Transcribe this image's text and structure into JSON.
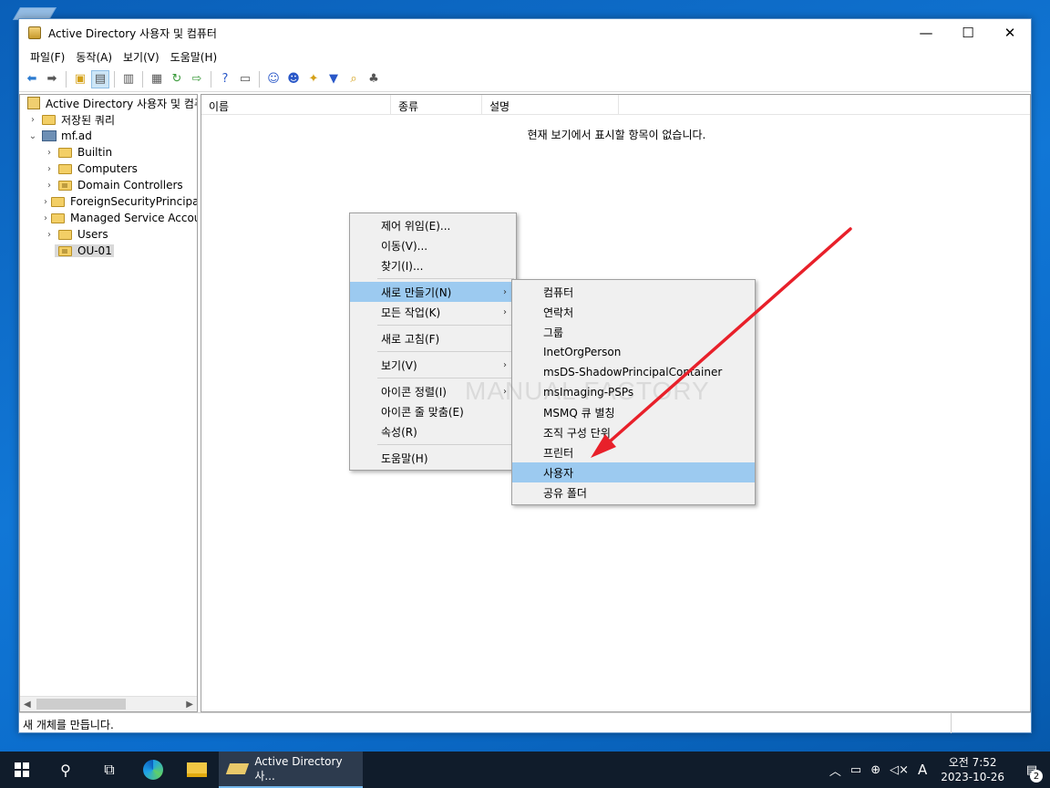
{
  "window": {
    "title": "Active Directory 사용자 및 컴퓨터",
    "controls": {
      "minimize": "—",
      "maximize": "☐",
      "close": "✕"
    }
  },
  "menubar": [
    "파일(F)",
    "동작(A)",
    "보기(V)",
    "도움말(H)"
  ],
  "tree": {
    "root": "Active Directory 사용자 및 컴퓨터",
    "saved_queries": "저장된 쿼리",
    "domain": "mf.ad",
    "children": [
      "Builtin",
      "Computers",
      "Domain Controllers",
      "ForeignSecurityPrincipals",
      "Managed Service Accounts",
      "Users",
      "OU-01"
    ]
  },
  "list": {
    "columns": [
      "이름",
      "종류",
      "설명"
    ],
    "empty_message": "현재 보기에서 표시할 항목이 없습니다."
  },
  "status": {
    "text": "새 개체를 만듭니다."
  },
  "context_menu": {
    "items": [
      {
        "label": "제어 위임(E)...",
        "sub": false
      },
      {
        "label": "이동(V)...",
        "sub": false
      },
      {
        "label": "찾기(I)...",
        "sub": false
      },
      {
        "sep": true
      },
      {
        "label": "새로 만들기(N)",
        "sub": true,
        "highlight": true
      },
      {
        "label": "모든 작업(K)",
        "sub": true
      },
      {
        "sep": true
      },
      {
        "label": "새로 고침(F)",
        "sub": false
      },
      {
        "sep": true
      },
      {
        "label": "보기(V)",
        "sub": true
      },
      {
        "sep": true
      },
      {
        "label": "아이콘 정렬(I)",
        "sub": true
      },
      {
        "label": "아이콘 줄 맞춤(E)",
        "sub": false
      },
      {
        "label": "속성(R)",
        "sub": false
      },
      {
        "sep": true
      },
      {
        "label": "도움말(H)",
        "sub": false
      }
    ]
  },
  "submenu": {
    "items": [
      "컴퓨터",
      "연락처",
      "그룹",
      "InetOrgPerson",
      "msDS-ShadowPrincipalContainer",
      "msImaging-PSPs",
      "MSMQ 큐 별칭",
      "조직 구성 단위",
      "프린터",
      "사용자",
      "공유 폴더"
    ],
    "highlighted": "사용자"
  },
  "watermark": "MANUAL FACTORY",
  "taskbar": {
    "app_label": "Active Directory 사...",
    "time": "오전 7:52",
    "date": "2023-10-26",
    "ime": "A",
    "notifications": "2"
  },
  "colors": {
    "accent": "#76b9ed",
    "highlight": "#9ccaf0",
    "arrow": "#e8202a"
  }
}
